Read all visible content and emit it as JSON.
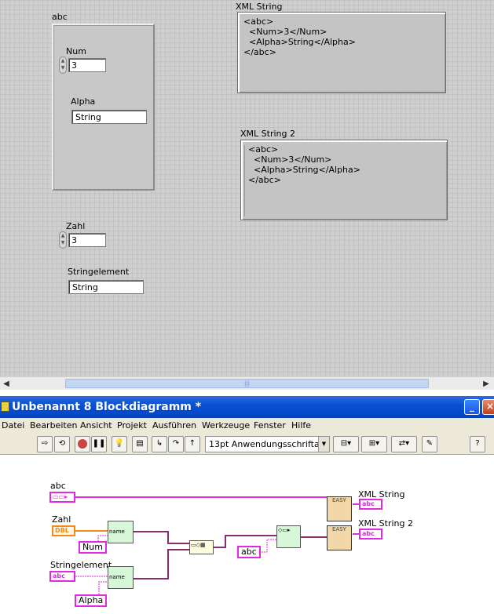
{
  "front_panel": {
    "cluster": {
      "label": "abc",
      "num_label": "Num",
      "num_value": "3",
      "alpha_label": "Alpha",
      "alpha_value": "String"
    },
    "zahl_label": "Zahl",
    "zahl_value": "3",
    "stringelement_label": "Stringelement",
    "stringelement_value": "String",
    "xml1_label": "XML String",
    "xml1_value": "<abc>\n  <Num>3</Num>\n  <Alpha>String</Alpha>\n</abc>",
    "xml2_label": "XML String 2",
    "xml2_value": "<abc>\n  <Num>3</Num>\n  <Alpha>String</Alpha>\n</abc>"
  },
  "scrollbar": {
    "left_icon": "arrow-left-icon",
    "right_icon": "arrow-right-icon",
    "thumb_grip": "|||"
  },
  "window": {
    "title": "Unbenannt 8 Blockdiagramm *",
    "minimize": "_",
    "close": "×"
  },
  "menu": [
    "Datei",
    "Bearbeiten",
    "Ansicht",
    "Projekt",
    "Ausführen",
    "Werkzeuge",
    "Fenster",
    "Hilfe"
  ],
  "toolbar": {
    "font_select": "13pt Anwendungsschriftart",
    "help": "?",
    "icons": [
      "run-arrow-icon",
      "run-continuous-icon",
      "abort-icon",
      "pause-icon",
      "highlight-execution-icon",
      "retain-wire-values-icon",
      "step-into-icon",
      "step-over-icon",
      "step-out-icon",
      "align-objects-icon",
      "distribute-objects-icon",
      "reorder-icon",
      "cleanup-diagram-icon"
    ]
  },
  "block_diagram": {
    "abc_label": "abc",
    "zahl_label": "Zahl",
    "zahl_term": "DBL",
    "num_const": "Num",
    "stringelement_label": "Stringelement",
    "stringelement_term": "abc",
    "alpha_const": "Alpha",
    "abc_const": "abc",
    "name_text": "name",
    "xml1_label": "XML String",
    "xml2_label": "XML String 2",
    "xml_term": "abc",
    "easy_text": "EASY"
  },
  "colors": {
    "string_wire": "#e228e2",
    "dbl_wire": "#f08a1a",
    "cluster_wire": "#9b3b82",
    "title_bar": "#0a50d4"
  }
}
